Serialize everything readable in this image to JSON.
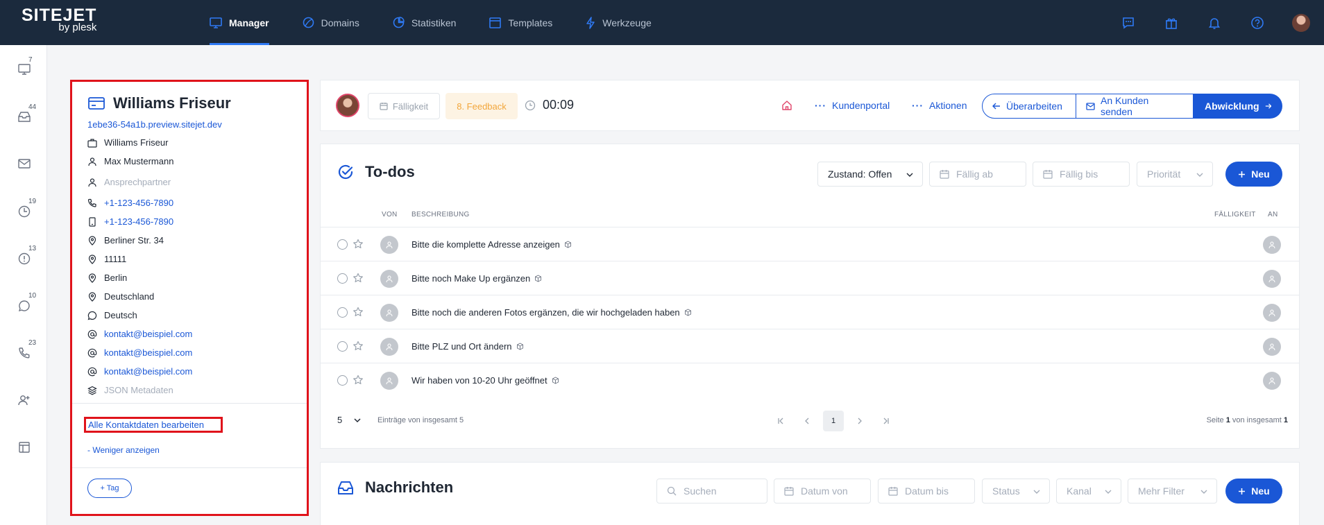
{
  "logo": {
    "brand": "SITEJET",
    "sub": "by plesk"
  },
  "nav": [
    {
      "label": "Manager",
      "icon": "monitor-icon",
      "active": true
    },
    {
      "label": "Domains",
      "icon": "globe-icon"
    },
    {
      "label": "Statistiken",
      "icon": "pie-chart-icon"
    },
    {
      "label": "Templates",
      "icon": "template-icon"
    },
    {
      "label": "Werkzeuge",
      "icon": "lightning-icon"
    }
  ],
  "top_icons": [
    "chat-icon",
    "gift-icon",
    "bell-icon",
    "help-icon",
    "user-avatar"
  ],
  "sidebar": [
    {
      "icon": "desktop-icon",
      "badge": "7"
    },
    {
      "icon": "inbox-icon",
      "badge": "44"
    },
    {
      "icon": "mail-icon",
      "badge": ""
    },
    {
      "icon": "clock-icon",
      "badge": "19"
    },
    {
      "icon": "alert-clock-icon",
      "badge": "13"
    },
    {
      "icon": "comment-icon",
      "badge": "10"
    },
    {
      "icon": "phone-icon",
      "badge": "23"
    },
    {
      "icon": "add-user-icon",
      "badge": ""
    },
    {
      "icon": "layout-icon",
      "badge": ""
    }
  ],
  "contact": {
    "name": "Williams Friseur",
    "preview_url": "1ebe36-54a1b.preview.sitejet.dev",
    "company": "Williams Friseur",
    "person": "Max Mustermann",
    "contact_person_placeholder": "Ansprechpartner",
    "phone": "+1-123-456-7890",
    "mobile": "+1-123-456-7890",
    "street": "Berliner Str. 34",
    "zip": "11111",
    "city": "Berlin",
    "country": "Deutschland",
    "language": "Deutsch",
    "emails": [
      "kontakt@beispiel.com",
      "kontakt@beispiel.com",
      "kontakt@beispiel.com"
    ],
    "json_meta": "JSON Metadaten",
    "edit_all": "Alle Kontaktdaten bearbeiten",
    "show_less": "- Weniger anzeigen",
    "tag_button": "+ Tag"
  },
  "header": {
    "due_label": "Fälligkeit",
    "feedback_label": "8. Feedback",
    "timer": "00:09",
    "customer_portal": "Kundenportal",
    "actions": "Aktionen",
    "revise": "Überarbeiten",
    "send_to_customer": "An Kunden senden",
    "process": "Abwicklung"
  },
  "todos": {
    "title": "To-dos",
    "filter_state": "Zustand: Offen",
    "due_from": "Fällig ab",
    "due_to": "Fällig bis",
    "priority": "Priorität",
    "new_button": "Neu",
    "columns": {
      "from": "VON",
      "description": "BESCHREIBUNG",
      "due": "FÄLLIGKEIT",
      "to": "AN"
    },
    "rows": [
      "Bitte die komplette Adresse anzeigen",
      "Bitte noch Make Up ergänzen",
      "Bitte noch die anderen Fotos ergänzen, die wir hochgeladen haben",
      "Bitte PLZ und Ort ändern",
      "Wir haben von 10-20 Uhr geöffnet"
    ],
    "page_size": "5",
    "entries_text": "Einträge von insgesamt 5",
    "current_page": "1",
    "page_info_prefix": "Seite ",
    "page_info_current": "1",
    "page_info_mid": " von insgesamt ",
    "page_info_total": "1"
  },
  "messages": {
    "title": "Nachrichten",
    "search_placeholder": "Suchen",
    "date_from": "Datum von",
    "date_to": "Datum bis",
    "status": "Status",
    "channel": "Kanal",
    "more_filter": "Mehr Filter",
    "new_button": "Neu"
  },
  "colors": {
    "topbar": "#1b2a3d",
    "primary": "#1a57d6",
    "highlight": "#e0131b",
    "feedback": "#f2a63b"
  }
}
